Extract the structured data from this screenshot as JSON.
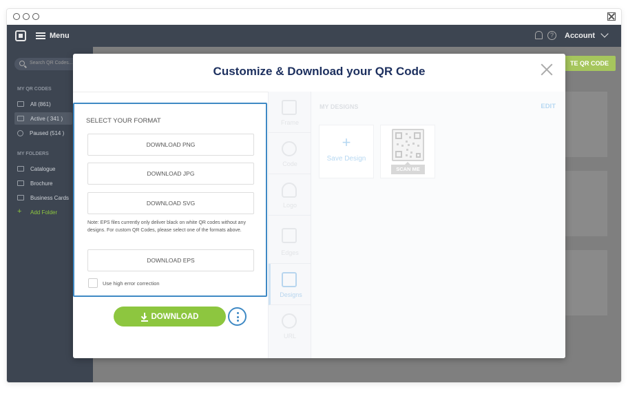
{
  "window": {
    "controls": [
      "circle",
      "circle",
      "circle"
    ]
  },
  "topbar": {
    "menu_label": "Menu",
    "account_label": "Account",
    "help_glyph": "?"
  },
  "sidebar": {
    "search_placeholder": "Search QR Codes...",
    "qr_heading": "MY QR CODES",
    "qr_items": [
      {
        "label": "All (861)"
      },
      {
        "label": "Active ( 341 )"
      },
      {
        "label": "Paused (514 )"
      }
    ],
    "folders_heading": "MY FOLDERS",
    "folders": [
      {
        "label": "Catalogue"
      },
      {
        "label": "Brochure"
      },
      {
        "label": "Business Cards"
      }
    ],
    "add_folder": "Add Folder",
    "add_glyph": "+"
  },
  "content": {
    "create_label": "TE QR CODE"
  },
  "modal": {
    "title": "Customize & Download your QR Code",
    "format": {
      "heading": "SELECT YOUR FORMAT",
      "png": "DOWNLOAD PNG",
      "jpg": "DOWNLOAD JPG",
      "svg": "DOWNLOAD SVG",
      "note": "Note: EPS files currently only deliver black on white QR codes without any designs. For custom QR Codes, please select one of the formats above.",
      "eps": "DOWNLOAD EPS",
      "error_correction": "Use  high error correction"
    },
    "download_label": "DOWNLOAD",
    "tabs": [
      {
        "label": "Frame"
      },
      {
        "label": "Code"
      },
      {
        "label": "Logo"
      },
      {
        "label": "Edges"
      },
      {
        "label": "Designs"
      },
      {
        "label": "URL"
      }
    ],
    "designs": {
      "heading": "MY DESIGNS",
      "edit": "EDIT",
      "save_design": "Save Design",
      "plus_glyph": "+",
      "scan_me": "SCAN ME"
    }
  },
  "colors": {
    "accent_blue": "#3e89c4",
    "accent_green": "#8dc63f",
    "title_navy": "#1c2f5e",
    "topbar": "#3d4551"
  }
}
